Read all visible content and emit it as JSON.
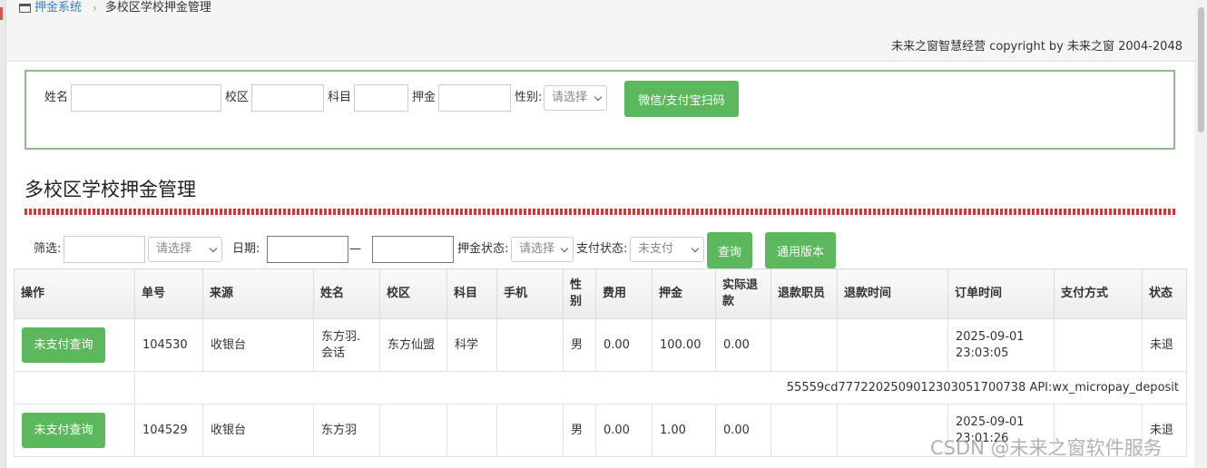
{
  "breadcrumb": {
    "root": "押金系统",
    "current": "多校区学校押金管理"
  },
  "copyright": "未来之窗智慧经营 copyright by 未来之窗 2004-2048",
  "scan_form": {
    "name_label": "姓名",
    "campus_label": "校区",
    "subject_label": "科目",
    "deposit_label": "押金",
    "gender_label": "性别:",
    "gender_value": "请选择",
    "scan_button": "微信/支付宝扫码"
  },
  "page_title": "多校区学校押金管理",
  "filter": {
    "filter_label": "筛选:",
    "filter_select": "请选择",
    "date_label": "日期:",
    "date_separator": "—",
    "deposit_status_label": "押金状态:",
    "deposit_status_value": "请选择",
    "pay_status_label": "支付状态:",
    "pay_status_value": "未支付",
    "query_button": "查询",
    "generic_button": "通用版本"
  },
  "table": {
    "headers": [
      "操作",
      "单号",
      "来源",
      "姓名",
      "校区",
      "科目",
      "手机",
      "性别",
      "费用",
      "押金",
      "实际退款",
      "退款职员",
      "退款时间",
      "订单时间",
      "支付方式",
      "状态"
    ],
    "rows": [
      {
        "action": "未支付查询",
        "order_no": "104530",
        "source": "收银台",
        "name": "东方羽.会话",
        "campus": "东方仙盟",
        "subject": "科学",
        "phone": "",
        "gender": "男",
        "fee": "0.00",
        "deposit": "100.00",
        "refund": "0.00",
        "refund_staff": "",
        "refund_time": "",
        "order_time": "2025-09-01 23:03:05",
        "pay_method": "",
        "status": "未退",
        "detail": "55559cd7772202509012303051700738 API:wx_micropay_deposit"
      },
      {
        "action": "未支付查询",
        "order_no": "104529",
        "source": "收银台",
        "name": "东方羽",
        "campus": "",
        "subject": "",
        "phone": "",
        "gender": "男",
        "fee": "0.00",
        "deposit": "1.00",
        "refund": "0.00",
        "refund_staff": "",
        "refund_time": "",
        "order_time": "2025-09-01 23:01:26",
        "pay_method": "",
        "status": "未退",
        "detail": ""
      }
    ]
  },
  "watermark": "CSDN @未来之窗软件服务"
}
